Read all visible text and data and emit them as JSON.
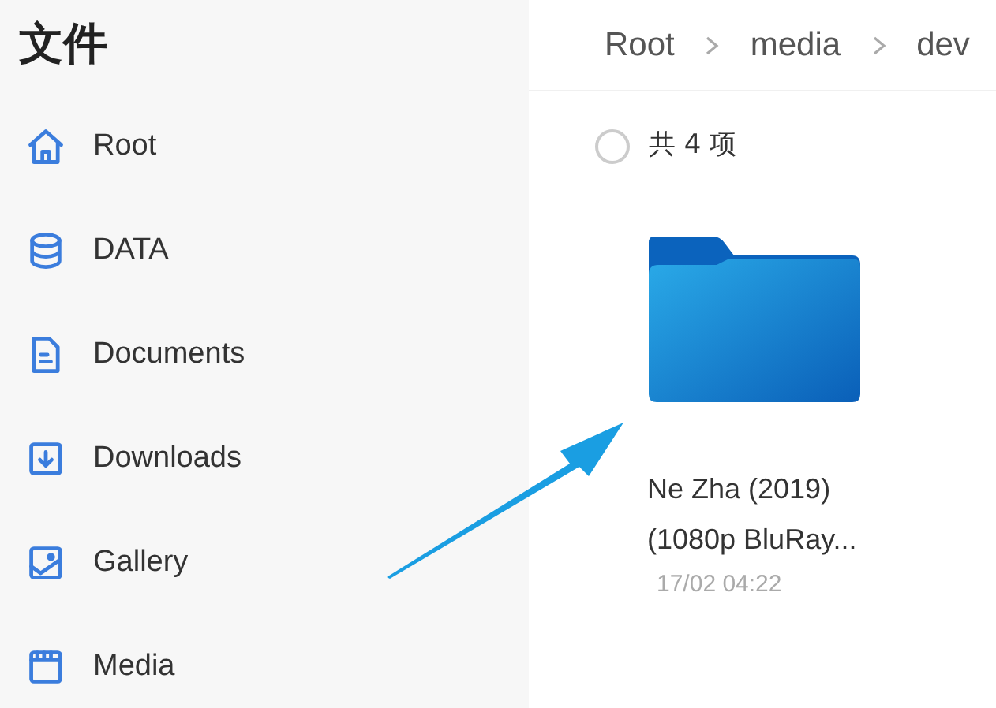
{
  "sidebar": {
    "title": "文件",
    "items": [
      {
        "label": "Root",
        "kind": "home"
      },
      {
        "label": "DATA",
        "kind": "database"
      },
      {
        "label": "Documents",
        "kind": "document"
      },
      {
        "label": "Downloads",
        "kind": "download"
      },
      {
        "label": "Gallery",
        "kind": "gallery"
      },
      {
        "label": "Media",
        "kind": "media"
      }
    ]
  },
  "breadcrumb": [
    "Root",
    "media",
    "dev"
  ],
  "selection": {
    "checked": false,
    "count_label": "共 4 项"
  },
  "files": [
    {
      "name": "Ne Zha (2019) (1080p BluRay...",
      "date": "17/02 04:22",
      "kind": "folder"
    }
  ]
}
